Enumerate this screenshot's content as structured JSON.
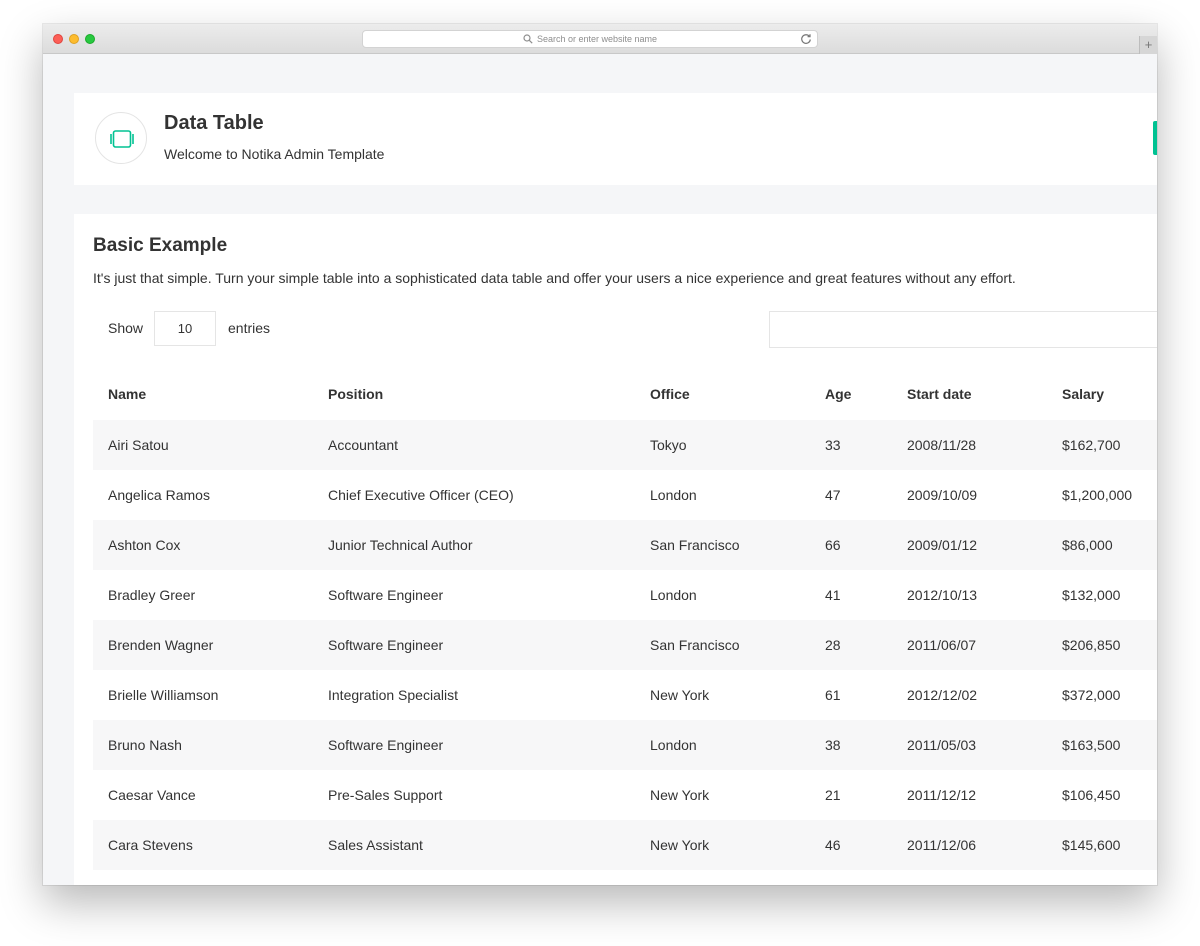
{
  "browser": {
    "url_placeholder": "Search or enter website name",
    "new_tab_symbol": "+"
  },
  "header": {
    "title": "Data Table",
    "subtitle": "Welcome to Notika Admin Template",
    "icon": "tablet-icon",
    "accent_color": "#00c292"
  },
  "main": {
    "title": "Basic Example",
    "description": "It's just that simple. Turn your simple table into a sophisticated data table and offer your users a nice experience and great features without any effort.",
    "show_label": "Show",
    "entries_value": "10",
    "entries_label": "entries",
    "search_value": ""
  },
  "table": {
    "columns": [
      "Name",
      "Position",
      "Office",
      "Age",
      "Start date",
      "Salary"
    ],
    "rows": [
      [
        "Airi Satou",
        "Accountant",
        "Tokyo",
        "33",
        "2008/11/28",
        "$162,700"
      ],
      [
        "Angelica Ramos",
        "Chief Executive Officer (CEO)",
        "London",
        "47",
        "2009/10/09",
        "$1,200,000"
      ],
      [
        "Ashton Cox",
        "Junior Technical Author",
        "San Francisco",
        "66",
        "2009/01/12",
        "$86,000"
      ],
      [
        "Bradley Greer",
        "Software Engineer",
        "London",
        "41",
        "2012/10/13",
        "$132,000"
      ],
      [
        "Brenden Wagner",
        "Software Engineer",
        "San Francisco",
        "28",
        "2011/06/07",
        "$206,850"
      ],
      [
        "Brielle Williamson",
        "Integration Specialist",
        "New York",
        "61",
        "2012/12/02",
        "$372,000"
      ],
      [
        "Bruno Nash",
        "Software Engineer",
        "London",
        "38",
        "2011/05/03",
        "$163,500"
      ],
      [
        "Caesar Vance",
        "Pre-Sales Support",
        "New York",
        "21",
        "2011/12/12",
        "$106,450"
      ],
      [
        "Cara Stevens",
        "Sales Assistant",
        "New York",
        "46",
        "2011/12/06",
        "$145,600"
      ]
    ]
  }
}
